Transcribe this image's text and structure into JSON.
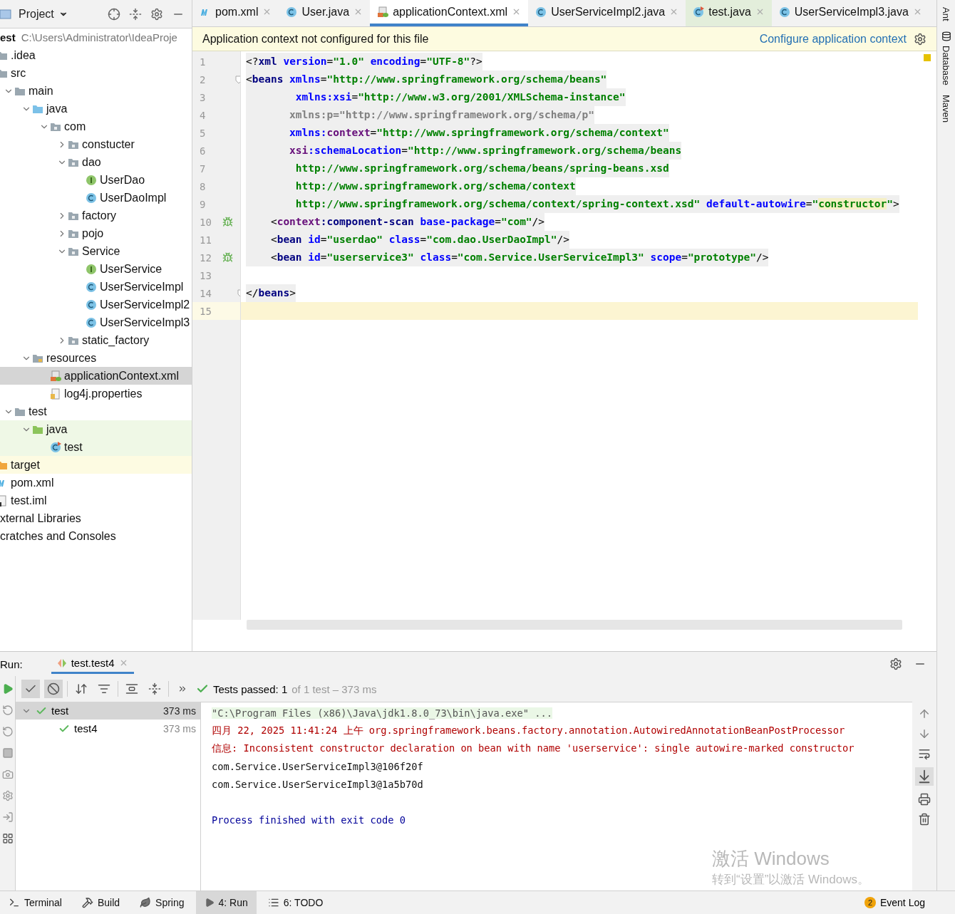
{
  "project_panel": {
    "title": "Project",
    "root": {
      "name": "est",
      "path": "C:\\Users\\Administrator\\IdeaProje"
    },
    "tree": [
      {
        "label": ".idea",
        "kind": "folder",
        "selected": false
      },
      {
        "label": "src",
        "kind": "folder",
        "selected": false,
        "children": [
          {
            "label": "main",
            "kind": "folder",
            "expanded": true,
            "selected": false,
            "children": [
              {
                "label": "java",
                "kind": "source",
                "expanded": true,
                "selected": false,
                "children": [
                  {
                    "label": "com",
                    "kind": "package",
                    "expanded": true,
                    "selected": false,
                    "children": [
                      {
                        "label": "constucter",
                        "kind": "package",
                        "expanded": false,
                        "selected": false
                      },
                      {
                        "label": "dao",
                        "kind": "package",
                        "expanded": true,
                        "selected": false,
                        "children": [
                          {
                            "label": "UserDao",
                            "kind": "interface",
                            "selected": false
                          },
                          {
                            "label": "UserDaoImpl",
                            "kind": "class",
                            "selected": false
                          }
                        ]
                      },
                      {
                        "label": "factory",
                        "kind": "package",
                        "expanded": false,
                        "selected": false
                      },
                      {
                        "label": "pojo",
                        "kind": "package",
                        "expanded": false,
                        "selected": false
                      },
                      {
                        "label": "Service",
                        "kind": "package",
                        "expanded": true,
                        "selected": false,
                        "children": [
                          {
                            "label": "UserService",
                            "kind": "interface",
                            "selected": false
                          },
                          {
                            "label": "UserServiceImpl",
                            "kind": "class",
                            "selected": false
                          },
                          {
                            "label": "UserServiceImpl2",
                            "kind": "class",
                            "selected": false
                          },
                          {
                            "label": "UserServiceImpl3",
                            "kind": "class",
                            "selected": false
                          }
                        ]
                      },
                      {
                        "label": "static_factory",
                        "kind": "package",
                        "expanded": false,
                        "selected": false
                      }
                    ]
                  }
                ]
              },
              {
                "label": "resources",
                "kind": "resources",
                "expanded": true,
                "selected": false,
                "children": [
                  {
                    "label": "applicationContext.xml",
                    "kind": "xml",
                    "selected": true
                  },
                  {
                    "label": "log4j.properties",
                    "kind": "properties",
                    "selected": false
                  }
                ]
              }
            ]
          },
          {
            "label": "test",
            "kind": "folder",
            "expanded": true,
            "selected": false,
            "children": [
              {
                "label": "java",
                "kind": "test-source",
                "expanded": true,
                "selected": false,
                "test_scope": true,
                "children": [
                  {
                    "label": "test",
                    "kind": "test-class",
                    "selected": false,
                    "test_scope": true
                  }
                ]
              }
            ]
          }
        ]
      },
      {
        "label": "target",
        "kind": "excluded",
        "selected": false,
        "excluded": true
      },
      {
        "label": "pom.xml",
        "kind": "maven",
        "selected": false
      },
      {
        "label": "test.iml",
        "kind": "module",
        "selected": false
      }
    ],
    "extra_items": [
      "xternal Libraries",
      "cratches and Consoles"
    ]
  },
  "editor": {
    "tabs": [
      {
        "label": "pom.xml",
        "kind": "maven",
        "selected": false
      },
      {
        "label": "User.java",
        "kind": "class",
        "selected": false
      },
      {
        "label": "applicationContext.xml",
        "kind": "xml",
        "selected": true
      },
      {
        "label": "UserServiceImpl2.java",
        "kind": "class",
        "selected": false
      },
      {
        "label": "test.java",
        "kind": "test-class",
        "selected": false,
        "test_scope": true
      },
      {
        "label": "UserServiceImpl3.java",
        "kind": "class",
        "selected": false
      }
    ],
    "banner": {
      "message": "Application context not configured for this file",
      "link": "Configure application context"
    },
    "lines": [
      {
        "number": "1",
        "shaded": true,
        "current": false,
        "tokens": [
          {
            "kind": "punct",
            "text": "<?"
          },
          {
            "kind": "tag",
            "text": "xml"
          },
          {
            "kind": "attr",
            "text": " version"
          },
          {
            "kind": "punct",
            "text": "="
          },
          {
            "kind": "value",
            "text": "\"1.0\""
          },
          {
            "kind": "attr",
            "text": " encoding"
          },
          {
            "kind": "punct",
            "text": "="
          },
          {
            "kind": "value",
            "text": "\"UTF-8\""
          },
          {
            "kind": "punct",
            "text": "?>"
          }
        ]
      },
      {
        "number": "2",
        "shaded": true,
        "current": false,
        "foldable": true,
        "tokens": [
          {
            "kind": "punct",
            "text": "<"
          },
          {
            "kind": "tag",
            "text": "beans"
          },
          {
            "kind": "attr",
            "text": " xmlns"
          },
          {
            "kind": "punct",
            "text": "="
          },
          {
            "kind": "value",
            "text": "\"http://www.springframework.org/schema/beans\""
          }
        ]
      },
      {
        "number": "3",
        "shaded": true,
        "current": false,
        "tokens": [
          {
            "kind": "attr",
            "text": "        xmlns:xsi"
          },
          {
            "kind": "punct",
            "text": "="
          },
          {
            "kind": "value",
            "text": "\"http://www.w3.org/2001/XMLSchema-instance\""
          }
        ]
      },
      {
        "number": "4",
        "shaded": true,
        "current": false,
        "tokens": [
          {
            "kind": "unused",
            "text": "       xmlns:p=\"http://www.springframework.org/schema/p\""
          }
        ]
      },
      {
        "number": "5",
        "shaded": true,
        "current": false,
        "tokens": [
          {
            "kind": "attr",
            "text": "       xmlns:"
          },
          {
            "kind": "ns",
            "text": "context"
          },
          {
            "kind": "punct",
            "text": "="
          },
          {
            "kind": "value",
            "text": "\"http://www.springframework.org/schema/context\""
          }
        ]
      },
      {
        "number": "6",
        "shaded": true,
        "current": false,
        "tokens": [
          {
            "kind": "ns",
            "text": "       xsi"
          },
          {
            "kind": "attr",
            "text": ":schemaLocation"
          },
          {
            "kind": "punct",
            "text": "="
          },
          {
            "kind": "value",
            "text": "\"http://www.springframework.org/schema/beans"
          }
        ]
      },
      {
        "number": "7",
        "shaded": true,
        "current": false,
        "tokens": [
          {
            "kind": "value",
            "text": "        http://www.springframework.org/schema/beans/spring-beans.xsd"
          }
        ]
      },
      {
        "number": "8",
        "shaded": true,
        "current": false,
        "tokens": [
          {
            "kind": "value",
            "text": "        http://www.springframework.org/schema/context"
          }
        ]
      },
      {
        "number": "9",
        "shaded": true,
        "current": false,
        "tokens": [
          {
            "kind": "value",
            "text": "        http://www.springframework.org/schema/context/spring-context.xsd\""
          },
          {
            "kind": "attr",
            "text": " default-autowire"
          },
          {
            "kind": "punct",
            "text": "="
          },
          {
            "kind": "value",
            "text": "\""
          },
          {
            "kind": "match",
            "text": "constructor"
          },
          {
            "kind": "value",
            "text": "\""
          },
          {
            "kind": "punct",
            "text": ">"
          }
        ]
      },
      {
        "number": "10",
        "shaded": true,
        "current": false,
        "bean": true,
        "tokens": [
          {
            "kind": "punct",
            "text": "    <"
          },
          {
            "kind": "ns",
            "text": "context"
          },
          {
            "kind": "tag",
            "text": ":component-scan"
          },
          {
            "kind": "attr",
            "text": " base-package"
          },
          {
            "kind": "punct",
            "text": "="
          },
          {
            "kind": "value",
            "text": "\"com\""
          },
          {
            "kind": "punct",
            "text": "/>"
          }
        ]
      },
      {
        "number": "11",
        "shaded": true,
        "current": false,
        "tokens": [
          {
            "kind": "punct",
            "text": "    <"
          },
          {
            "kind": "tag",
            "text": "bean"
          },
          {
            "kind": "attr",
            "text": " id"
          },
          {
            "kind": "punct",
            "text": "="
          },
          {
            "kind": "value",
            "text": "\"userdao\""
          },
          {
            "kind": "attr",
            "text": " class"
          },
          {
            "kind": "punct",
            "text": "="
          },
          {
            "kind": "value",
            "text": "\"com.dao.UserDaoImpl\""
          },
          {
            "kind": "punct",
            "text": "/>"
          }
        ]
      },
      {
        "number": "12",
        "shaded": true,
        "current": false,
        "bean": true,
        "tokens": [
          {
            "kind": "punct",
            "text": "    <"
          },
          {
            "kind": "tag",
            "text": "bean"
          },
          {
            "kind": "attr",
            "text": " id"
          },
          {
            "kind": "punct",
            "text": "="
          },
          {
            "kind": "value",
            "text": "\"userservice3\""
          },
          {
            "kind": "attr",
            "text": " class"
          },
          {
            "kind": "punct",
            "text": "="
          },
          {
            "kind": "value",
            "text": "\"com.Service.UserServiceImpl3\""
          },
          {
            "kind": "attr",
            "text": " scope"
          },
          {
            "kind": "punct",
            "text": "="
          },
          {
            "kind": "value",
            "text": "\"prototype\""
          },
          {
            "kind": "punct",
            "text": "/>"
          }
        ]
      },
      {
        "number": "13",
        "current": false
      },
      {
        "number": "14",
        "shaded": true,
        "current": false,
        "foldable": true,
        "tokens": [
          {
            "kind": "punct",
            "text": "</"
          },
          {
            "kind": "tag",
            "text": "beans"
          },
          {
            "kind": "punct",
            "text": ">"
          }
        ]
      },
      {
        "number": "15",
        "current": true
      }
    ]
  },
  "side_tools": [
    "Ant",
    "Database",
    "Maven"
  ],
  "run_panel": {
    "label": "Run:",
    "tab": "test.test4",
    "status": "Tests passed: 1",
    "status_detail": "of 1 test – 373 ms",
    "tests": [
      {
        "name": "test",
        "time": "373 ms",
        "expanded": true,
        "selected": true,
        "children": [
          {
            "name": "test4",
            "time": "373 ms",
            "selected": false
          }
        ]
      }
    ],
    "console": [
      {
        "kind": "command",
        "text": "\"C:\\Program Files (x86)\\Java\\jdk1.8.0_73\\bin\\java.exe\" ..."
      },
      {
        "kind": "error",
        "text": "四月 22, 2025 11:41:24 上午 org.springframework.beans.factory.annotation.AutowiredAnnotationBeanPostProcessor"
      },
      {
        "kind": "error",
        "text": "信息: Inconsistent constructor declaration on bean with name 'userservice': single autowire-marked constructor"
      },
      {
        "kind": "output",
        "text": "com.Service.UserServiceImpl3@106f20f"
      },
      {
        "kind": "output",
        "text": "com.Service.UserServiceImpl3@1a5b70d"
      },
      {
        "kind": "blank"
      },
      {
        "kind": "exit",
        "text": "Process finished with exit code 0"
      }
    ]
  },
  "activation_notice": {
    "title": "激活 Windows",
    "subtitle": "转到“设置”以激活 Windows。"
  },
  "bottom_bar": {
    "tools": [
      {
        "label": "Terminal",
        "kind": "terminal",
        "selected": false
      },
      {
        "label": "Build",
        "kind": "hammer",
        "selected": false
      },
      {
        "label": "Spring",
        "kind": "leaf",
        "selected": false
      },
      {
        "label": "4: Run",
        "kind": "play",
        "selected": true
      },
      {
        "label": "6: TODO",
        "kind": "list",
        "selected": false
      }
    ],
    "event_log": {
      "label": "Event Log",
      "count": "2"
    }
  }
}
